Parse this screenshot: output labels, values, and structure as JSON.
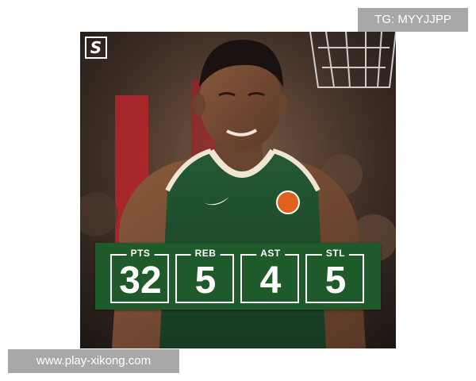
{
  "brand": {
    "logo_text": "S"
  },
  "stats": [
    {
      "label": "PTS",
      "value": "32"
    },
    {
      "label": "REB",
      "value": "5"
    },
    {
      "label": "AST",
      "value": "4"
    },
    {
      "label": "STL",
      "value": "5"
    }
  ],
  "watermarks": {
    "top_right": "TG: MYYJJPP",
    "bottom_left": "www.play-xikong.com"
  },
  "colors": {
    "banner_green": "#1f5a2a",
    "jersey_green": "#1d4a2a",
    "watermark_gray": "#a8a8a8"
  }
}
